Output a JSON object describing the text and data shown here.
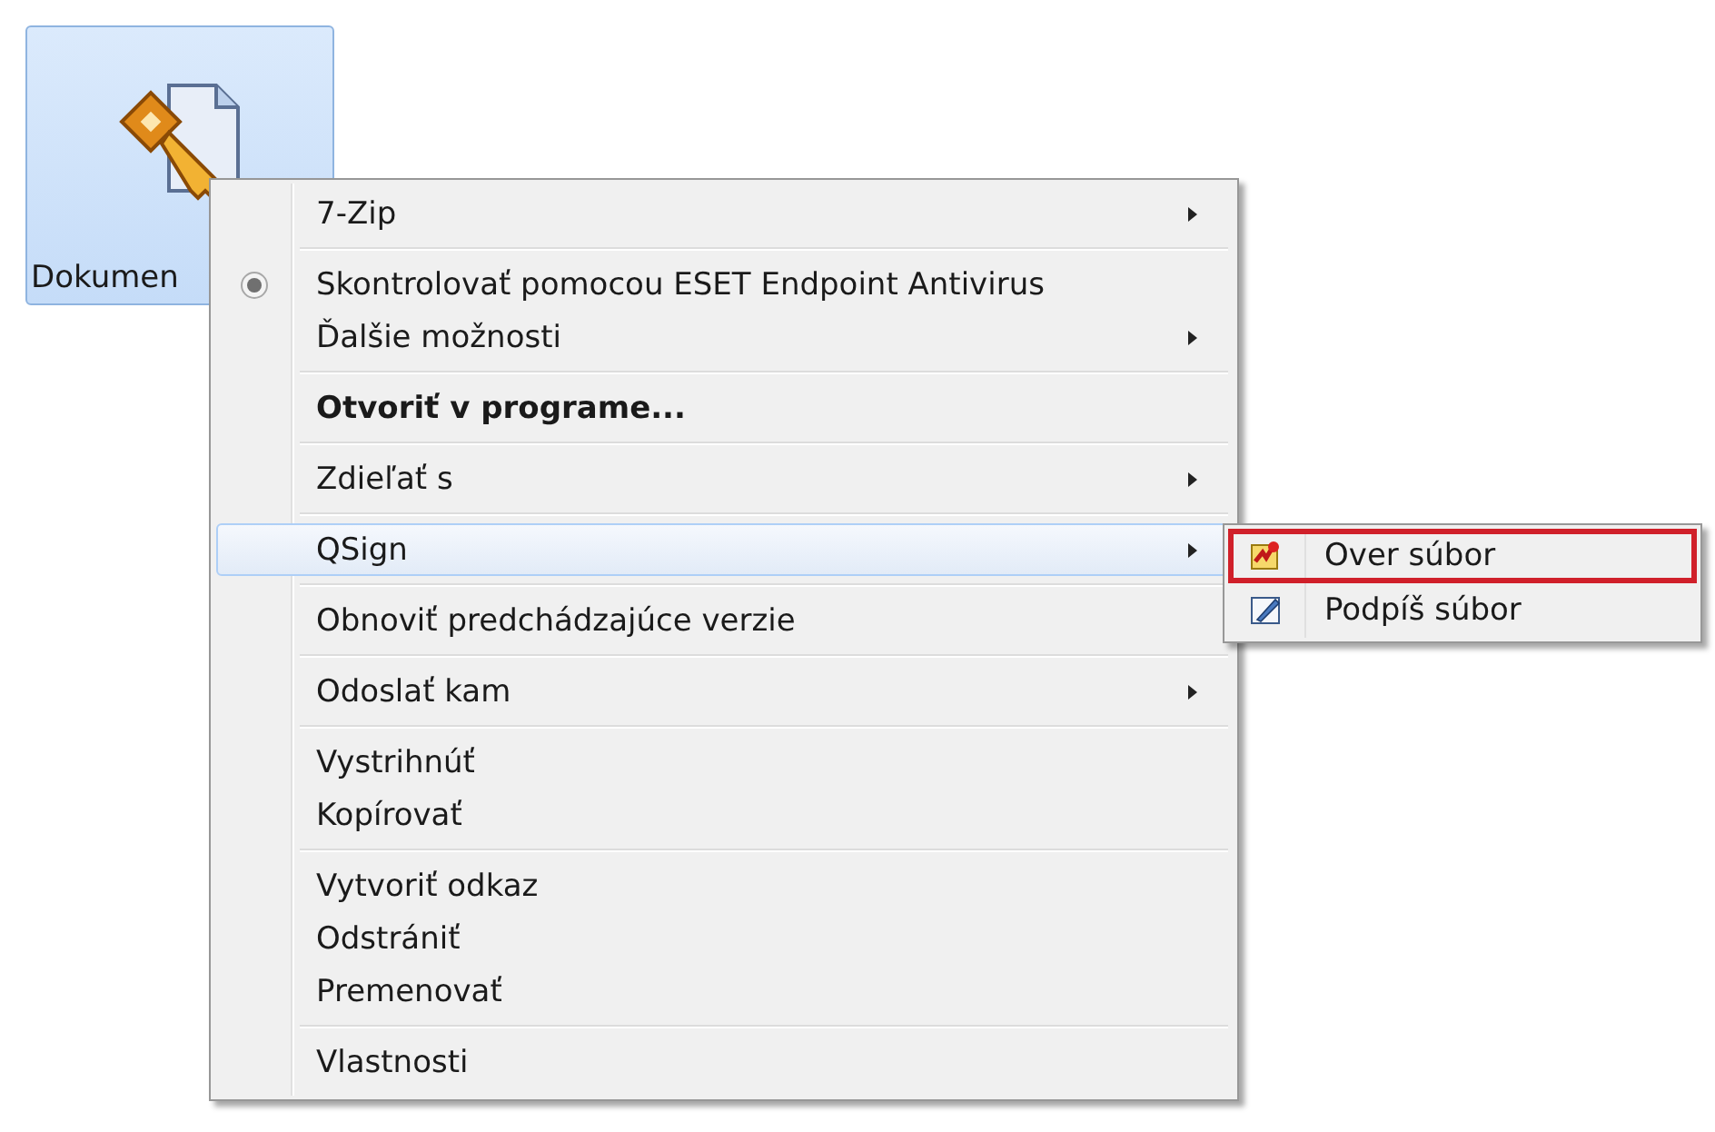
{
  "desktop_icon": {
    "label": "Dokumen",
    "selected": true
  },
  "context_menu": {
    "items": [
      {
        "kind": "item",
        "label": "7-Zip",
        "submenu": true,
        "bold": false,
        "icon": false,
        "selected": false
      },
      {
        "kind": "separator"
      },
      {
        "kind": "item",
        "label": "Skontrolovať pomocou ESET Endpoint Antivirus",
        "submenu": false,
        "bold": false,
        "icon": true,
        "selected": false
      },
      {
        "kind": "item",
        "label": "Ďalšie možnosti",
        "submenu": true,
        "bold": false,
        "icon": false,
        "selected": false
      },
      {
        "kind": "separator"
      },
      {
        "kind": "item",
        "label": "Otvoriť v programe...",
        "submenu": false,
        "bold": true,
        "icon": false,
        "selected": false
      },
      {
        "kind": "separator"
      },
      {
        "kind": "item",
        "label": "Zdieľať s",
        "submenu": true,
        "bold": false,
        "icon": false,
        "selected": false
      },
      {
        "kind": "separator"
      },
      {
        "kind": "item",
        "label": "QSign",
        "submenu": true,
        "bold": false,
        "icon": false,
        "selected": true
      },
      {
        "kind": "separator"
      },
      {
        "kind": "item",
        "label": "Obnoviť predchádzajúce verzie",
        "submenu": false,
        "bold": false,
        "icon": false,
        "selected": false
      },
      {
        "kind": "separator"
      },
      {
        "kind": "item",
        "label": "Odoslať kam",
        "submenu": true,
        "bold": false,
        "icon": false,
        "selected": false
      },
      {
        "kind": "separator"
      },
      {
        "kind": "item",
        "label": "Vystrihnúť",
        "submenu": false,
        "bold": false,
        "icon": false,
        "selected": false
      },
      {
        "kind": "item",
        "label": "Kopírovať",
        "submenu": false,
        "bold": false,
        "icon": false,
        "selected": false
      },
      {
        "kind": "separator"
      },
      {
        "kind": "item",
        "label": "Vytvoriť odkaz",
        "submenu": false,
        "bold": false,
        "icon": false,
        "selected": false
      },
      {
        "kind": "item",
        "label": "Odstrániť",
        "submenu": false,
        "bold": false,
        "icon": false,
        "selected": false
      },
      {
        "kind": "item",
        "label": "Premenovať",
        "submenu": false,
        "bold": false,
        "icon": false,
        "selected": false
      },
      {
        "kind": "separator"
      },
      {
        "kind": "item",
        "label": "Vlastnosti",
        "submenu": false,
        "bold": false,
        "icon": false,
        "selected": false
      }
    ]
  },
  "submenu": {
    "items": [
      {
        "kind": "verify",
        "label": "Over súbor",
        "selected": true
      },
      {
        "kind": "sign",
        "label": "Podpíš súbor",
        "selected": false
      }
    ]
  }
}
